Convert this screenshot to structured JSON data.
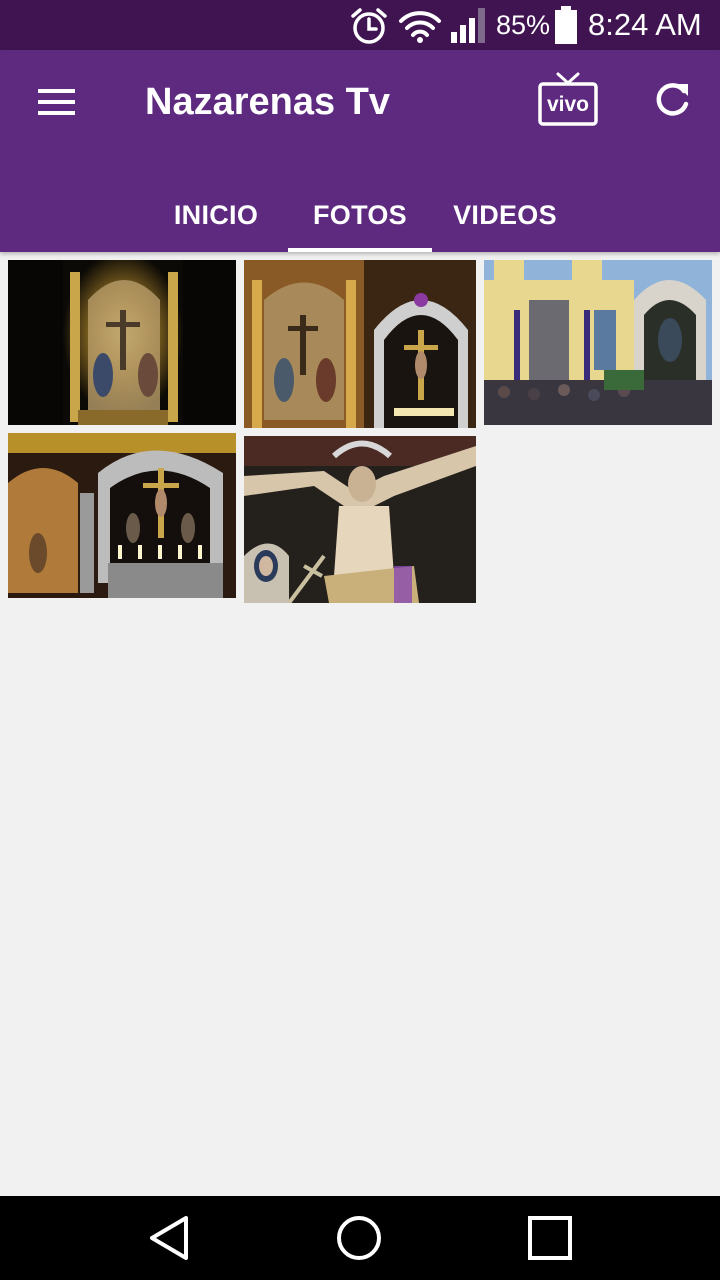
{
  "status_bar": {
    "battery_percent": "85%",
    "battery_level": 0.85,
    "time": "8:24 AM",
    "icons": [
      "alarm-icon",
      "wifi-icon",
      "signal-icon",
      "battery-icon"
    ]
  },
  "app_bar": {
    "title": "Nazarenas Tv",
    "menu_icon": "hamburger-menu-icon",
    "live_tv_label": "vivo",
    "refresh_icon": "refresh-icon"
  },
  "tabs": [
    {
      "label": "INICIO",
      "selected": false
    },
    {
      "label": "FOTOS",
      "selected": true
    },
    {
      "label": "VIDEOS",
      "selected": false
    }
  ],
  "gallery": {
    "photo_count": 5
  },
  "colors": {
    "status_bar": "#3f1450",
    "app_bar": "#5e2a80",
    "background": "#f1f1f1",
    "nav_bar": "#000000"
  },
  "nav_bar": {
    "icons": [
      "back-icon",
      "home-icon",
      "recents-icon"
    ]
  }
}
